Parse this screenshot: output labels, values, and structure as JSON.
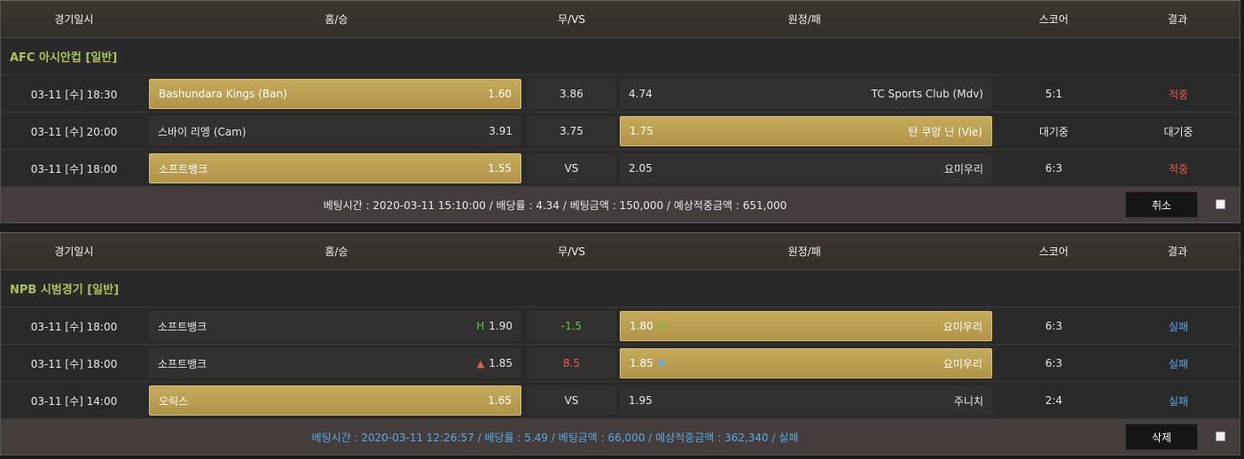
{
  "header": {
    "date": "경기일시",
    "home": "홈/승",
    "draw": "무/VS",
    "away": "원정/패",
    "score": "스코어",
    "result": "결과"
  },
  "slip1": {
    "league": "AFC 아시안컵 [일반]",
    "rows": [
      {
        "date": "03-11 [수] 18:30",
        "home": "Bashundara Kings (Ban)",
        "home_odds": "1.60",
        "draw": "3.86",
        "away_odds": "4.74",
        "away": "TC Sports Club (Mdv)",
        "score": "5:1",
        "result": "적중"
      },
      {
        "date": "03-11 [수] 20:00",
        "home": "스바이 리엥 (Cam)",
        "home_odds": "3.91",
        "draw": "3.75",
        "away_odds": "1.75",
        "away": "탄 쿠앙 닌 (Vie)",
        "score": "대기중",
        "result": "대기중"
      },
      {
        "date": "03-11 [수] 18:00",
        "home": "소프트뱅크",
        "home_odds": "1.55",
        "draw": "VS",
        "away_odds": "2.05",
        "away": "요미우리",
        "score": "6:3",
        "result": "적중"
      }
    ],
    "footer": "베팅시간 : 2020-03-11 15:10:00  /  배당률 : 4.34  /  베팅금액 : 150,000  /  예상적중금액 : 651,000",
    "button": "취소"
  },
  "slip2": {
    "league": "NPB 시범경기 [일반]",
    "rows": [
      {
        "date": "03-11 [수] 18:00",
        "home": "소프트뱅크",
        "home_mark": "H",
        "home_odds": "1.90",
        "draw": "-1.5",
        "away_odds": "1.80",
        "away_mark": "H",
        "away": "요미우리",
        "score": "6:3",
        "result": "실패"
      },
      {
        "date": "03-11 [수] 18:00",
        "home": "소프트뱅크",
        "home_mark": "▲",
        "home_odds": "1.85",
        "draw": "8.5",
        "away_odds": "1.85",
        "away_mark": "▼",
        "away": "요미우리",
        "score": "6:3",
        "result": "실패"
      },
      {
        "date": "03-11 [수] 14:00",
        "home": "오릭스",
        "home_odds": "1.65",
        "draw": "VS",
        "away_odds": "1.95",
        "away": "주니치",
        "score": "2:4",
        "result": "실패"
      }
    ],
    "footer": "베팅시간 : 2020-03-11 12:26:57  /  배당률 : 5.49  /  베팅금액 : 66,000  /  예상적중금액 : 362,340  / 실패",
    "button": "삭제"
  },
  "colors": {
    "win": "#e85b4e",
    "lose": "#5aa8e6",
    "selected": "#c6aa5b",
    "league": "#a9c25a"
  }
}
